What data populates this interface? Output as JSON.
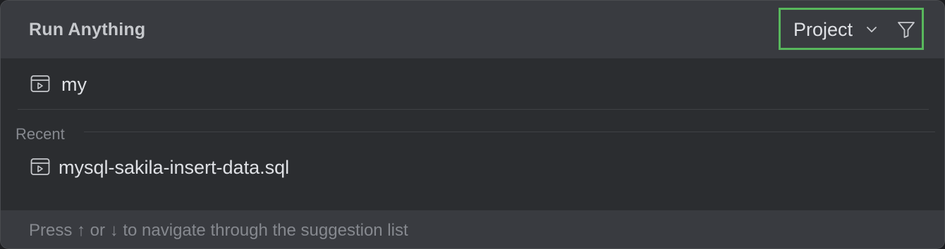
{
  "header": {
    "title": "Run Anything",
    "scope": {
      "label": "Project",
      "chevron_icon": "chevron-down-icon",
      "filter_icon": "filter-icon"
    }
  },
  "results": {
    "items": [
      {
        "label": "my",
        "icon": "run-configuration-icon"
      }
    ],
    "recent_section": {
      "title": "Recent",
      "items": [
        {
          "label": "mysql-sakila-insert-data.sql",
          "icon": "run-configuration-icon"
        }
      ]
    }
  },
  "footer": {
    "hint": "Press ↑ or ↓ to navigate through the suggestion list"
  },
  "colors": {
    "highlight_box": "#58b85c",
    "header_bg": "#393b40",
    "list_bg": "#2b2d30"
  }
}
